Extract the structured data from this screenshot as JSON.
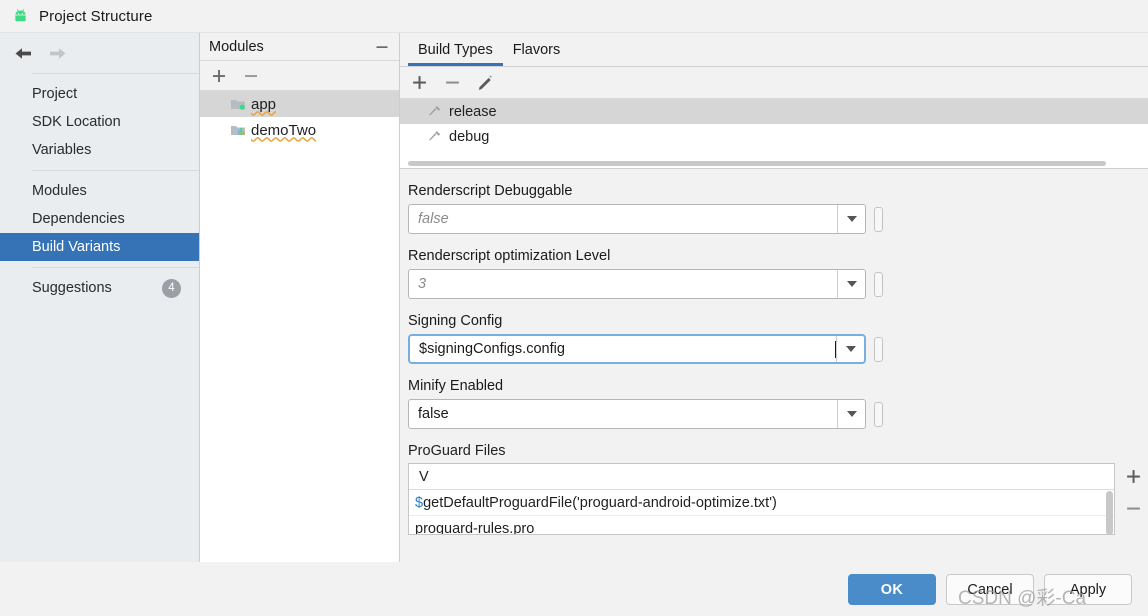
{
  "window": {
    "title": "Project Structure",
    "app_icon": "android-robot-icon"
  },
  "sidebar": {
    "nav": {
      "back_icon": "arrow-left-icon",
      "forward_icon": "arrow-right-icon"
    },
    "group_one": [
      {
        "label": "Project",
        "selected": false
      },
      {
        "label": "SDK Location",
        "selected": false
      },
      {
        "label": "Variables",
        "selected": false
      }
    ],
    "group_two": [
      {
        "label": "Modules",
        "selected": false
      },
      {
        "label": "Dependencies",
        "selected": false
      },
      {
        "label": "Build Variants",
        "selected": true
      }
    ],
    "group_three": [
      {
        "label": "Suggestions",
        "badge": "4"
      }
    ],
    "selected_color": "#3573b6",
    "background": "#e9edf0"
  },
  "modules_panel": {
    "title": "Modules",
    "collapse_icon": "minus-icon",
    "toolbar": {
      "add_icon": "plus-icon",
      "remove_icon": "minus-icon"
    },
    "items": [
      {
        "label": "app",
        "icon": "module-folder-green-dot-icon",
        "selected": true,
        "spellcheck_underline": true
      },
      {
        "label": "demoTwo",
        "icon": "module-folder-chart-icon",
        "selected": false,
        "spellcheck_underline": true
      }
    ]
  },
  "detail": {
    "tabs": [
      {
        "label": "Build Types",
        "active": true
      },
      {
        "label": "Flavors",
        "active": false
      }
    ],
    "toolbar": {
      "add_icon": "plus-icon",
      "remove_icon": "minus-icon",
      "edit_icon": "pencil-icon"
    },
    "build_types": [
      {
        "label": "release",
        "icon": "hammer-icon",
        "selected": true
      },
      {
        "label": "debug",
        "icon": "hammer-icon",
        "selected": false
      }
    ],
    "fields": [
      {
        "label": "Renderscript Debuggable",
        "value": "false",
        "inherited": true,
        "focused": false,
        "dropdown_icon": "chevron-down-icon",
        "variable_button": "variable-picker-button"
      },
      {
        "label": "Renderscript optimization Level",
        "value": "3",
        "inherited": true,
        "focused": false,
        "dropdown_icon": "chevron-down-icon",
        "variable_button": "variable-picker-button"
      },
      {
        "label": "Signing Config",
        "value": "$signingConfigs.config",
        "inherited": false,
        "focused": true,
        "dropdown_icon": "chevron-down-icon",
        "variable_button": "variable-picker-button"
      },
      {
        "label": "Minify Enabled",
        "value": "false",
        "inherited": false,
        "focused": false,
        "dropdown_icon": "chevron-down-icon",
        "variable_button": "variable-picker-button"
      }
    ],
    "proguard": {
      "label": "ProGuard Files",
      "column_header": "V",
      "rows": [
        {
          "prefix": "$",
          "text": "getDefaultProguardFile('proguard-android-optimize.txt')"
        },
        {
          "prefix": "",
          "text": "proguard-rules.pro"
        }
      ],
      "add_icon": "plus-icon",
      "remove_icon": "minus-icon"
    }
  },
  "footer": {
    "ok_label": "OK",
    "cancel_label": "Cancel",
    "apply_label": "Apply",
    "ok_color": "#4a8bc9"
  },
  "watermark": {
    "text": "CSDN @彩-Ca"
  }
}
